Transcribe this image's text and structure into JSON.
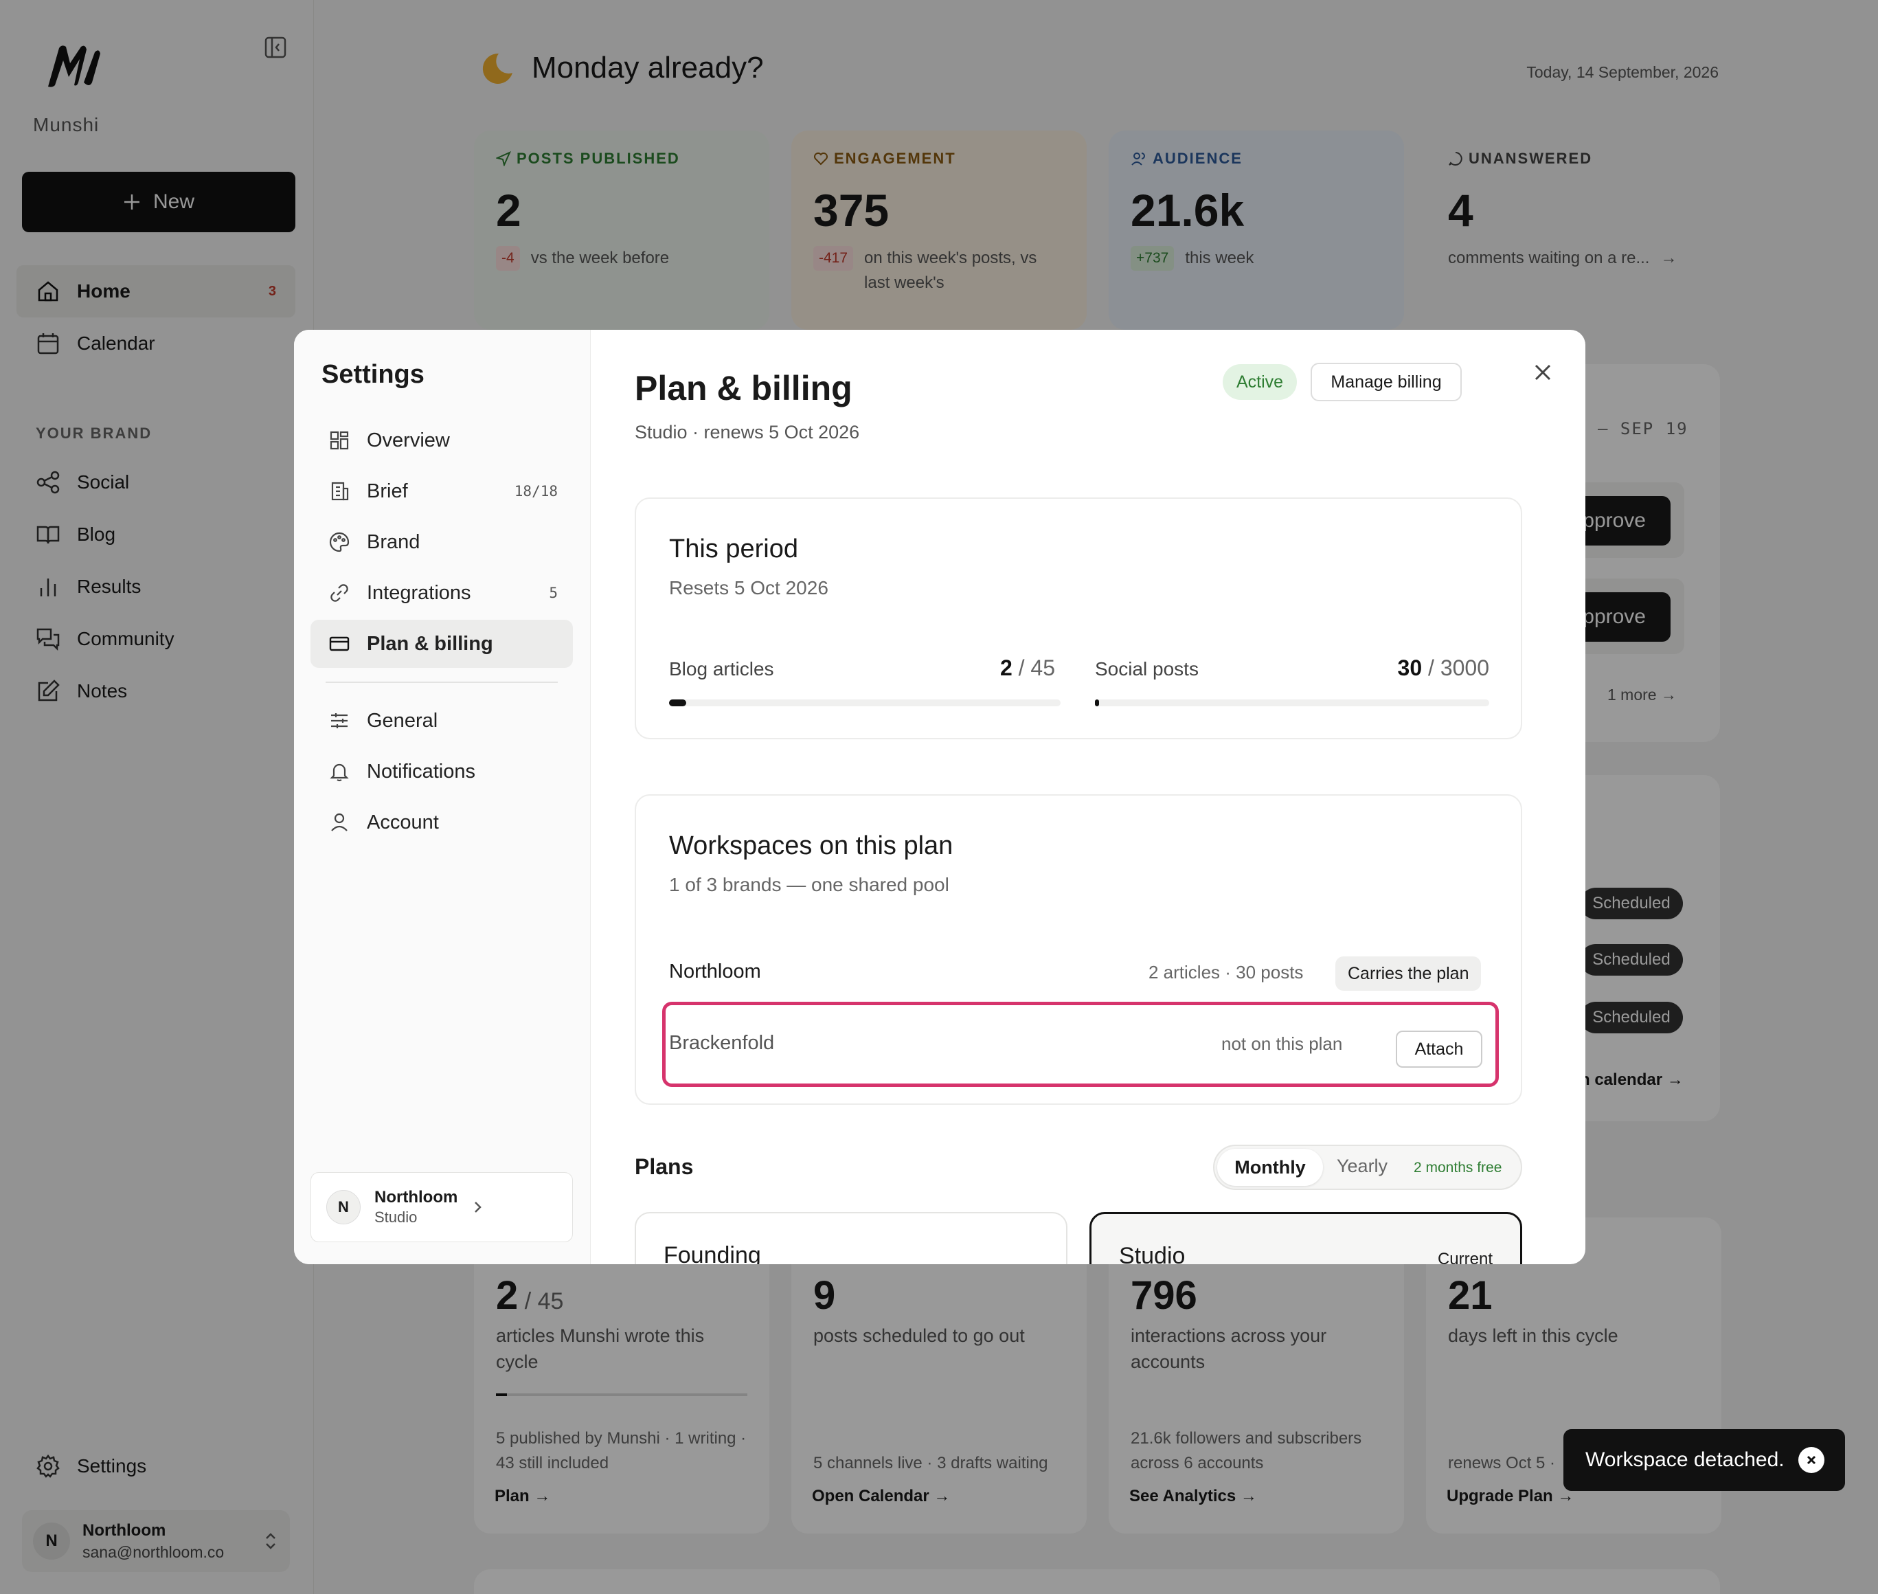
{
  "sidebar": {
    "brand_name": "Munshi",
    "new_label": "New",
    "nav": [
      {
        "label": "Home",
        "badge": "3"
      },
      {
        "label": "Calendar"
      },
      {
        "label": "Social"
      },
      {
        "label": "Blog"
      },
      {
        "label": "Results"
      },
      {
        "label": "Community"
      },
      {
        "label": "Notes"
      }
    ],
    "section_label": "YOUR BRAND",
    "settings_label": "Settings",
    "user": {
      "initial": "N",
      "name": "Northloom",
      "email": "sana@northloom.co"
    }
  },
  "main": {
    "greeting": "Monday already?",
    "date": "Today, 14 September, 2026",
    "stats": [
      {
        "label": "POSTS PUBLISHED",
        "value": "2",
        "delta": "-4",
        "sub": "vs the week before"
      },
      {
        "label": "ENGAGEMENT",
        "value": "375",
        "delta": "-417",
        "sub": "on this week's posts, vs last week's"
      },
      {
        "label": "AUDIENCE",
        "value": "21.6k",
        "delta": "+737",
        "sub": "this week"
      },
      {
        "label": "UNANSWERED",
        "value": "4",
        "sub": "comments waiting on a re..."
      }
    ],
    "week_range": "– SEP 19",
    "approve_label": "pprove",
    "more_label": "1 more",
    "scheduled_label": "Scheduled",
    "open_calendar_label": "n calendar →",
    "bottom_cards": [
      {
        "value": "2",
        "value_suffix": " / 45",
        "desc": "articles Munshi wrote this cycle",
        "foot": "5 published by Munshi · 1 writing · 43 still included",
        "link": "Plan →",
        "progress": 0.044
      },
      {
        "value": "9",
        "desc": "posts scheduled to go out",
        "foot": "5 channels live · 3 drafts waiting",
        "link": "Open Calendar →"
      },
      {
        "value": "796",
        "desc": "interactions across your accounts",
        "foot": "21.6k followers and subscribers across 6 accounts",
        "link": "See Analytics →"
      },
      {
        "value": "21",
        "desc": "days left in this cycle",
        "foot": "renews Oct 5 ·",
        "link": "Upgrade Plan →"
      }
    ]
  },
  "modal": {
    "title": "Settings",
    "nav": [
      {
        "label": "Overview"
      },
      {
        "label": "Brief",
        "count": "18/18"
      },
      {
        "label": "Brand"
      },
      {
        "label": "Integrations",
        "count": "5"
      },
      {
        "label": "Plan & billing"
      },
      {
        "label": "General"
      },
      {
        "label": "Notifications"
      },
      {
        "label": "Account"
      }
    ],
    "workspace": {
      "initial": "N",
      "name": "Northloom",
      "plan": "Studio"
    },
    "heading": "Plan & billing",
    "subheading": "Studio · renews 5 Oct 2026",
    "status": "Active",
    "manage_billing": "Manage billing",
    "period": {
      "title": "This period",
      "resets": "Resets 5 Oct 2026",
      "blog": {
        "label": "Blog articles",
        "used": "2",
        "limit": " / 45",
        "fraction": 0.044
      },
      "social": {
        "label": "Social posts",
        "used": "30",
        "limit": " / 3000",
        "fraction": 0.01
      }
    },
    "workspaces": {
      "title": "Workspaces on this plan",
      "sub": "1 of 3 brands — one shared pool",
      "rows": [
        {
          "name": "Northloom",
          "meta": "2 articles · 30 posts",
          "tag": "Carries the plan"
        },
        {
          "name": "Brackenfold",
          "meta": "not on this plan",
          "action": "Attach"
        }
      ]
    },
    "plans": {
      "title": "Plans",
      "monthly": "Monthly",
      "yearly": "Yearly",
      "yearly_note": "2 months free",
      "cards": [
        {
          "name": "Founding"
        },
        {
          "name": "Studio",
          "tag": "Current"
        }
      ]
    }
  },
  "toast": {
    "message": "Workspace detached."
  }
}
